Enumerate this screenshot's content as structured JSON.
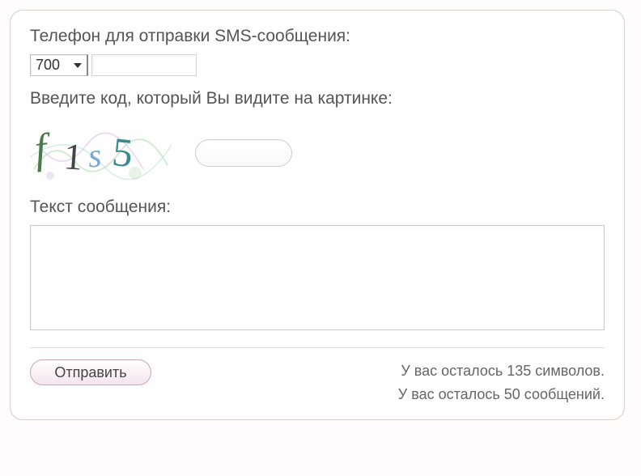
{
  "phone": {
    "label": "Телефон для отправки SMS-сообщения:",
    "prefix_selected": "700",
    "number_value": ""
  },
  "captcha": {
    "label": "Введите код, который Вы видите на картинке:",
    "chars": [
      "f",
      "1",
      "s",
      "5"
    ],
    "input_value": ""
  },
  "message": {
    "label": "Текст сообщения:",
    "value": ""
  },
  "send_button_label": "Отправить",
  "status": {
    "chars_remaining_text": "У вас осталось 135 символов.",
    "messages_remaining_text": "У вас осталось 50 сообщений."
  }
}
